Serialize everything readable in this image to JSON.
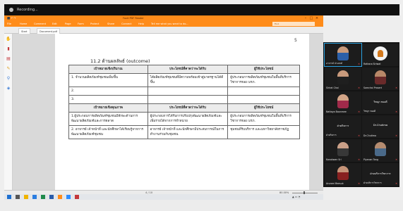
{
  "meeting": {
    "title": "Recording..."
  },
  "app": {
    "title": "Foxit PDF Reader",
    "menu_tabs": [
      "File",
      "Home",
      "Comment",
      "Edit",
      "Page",
      "Form",
      "Protect",
      "Share",
      "Connect",
      "Help"
    ],
    "search_placeholder": "Tell me what you want to do...",
    "find_placeholder": "Find",
    "doc_tabs": [
      "Start",
      "Document.pdf"
    ],
    "page_indicator": "4 / 10",
    "zoom_level": "80.00%"
  },
  "document": {
    "page_number": "5",
    "section_heading": "11.2  ด้านผลลัพธ์ (outcome)",
    "table": {
      "headers_1": [
        "เป้าหมายเชิงปริมาณ",
        "ประโยชน์ที่คาดว่าจะได้รับ",
        "ผู้ใช้ประโยชน์"
      ],
      "rows_1": [
        [
          "1. จำนวนผลิตภัณฑ์ชุมชนเพิ่มขึ้น",
          "ได้ผลิตภัณฑ์ชุมชนที่มีความพร้อมเข้าสู่มาตรฐานได้ดีขึ้น",
          "ผู้ประกอบการผลิตภัณฑ์ชุมชนในพื้นที่บริการวิชาการของ มรภ."
        ],
        [
          "2.",
          "",
          ""
        ],
        [
          "3.",
          "",
          ""
        ]
      ],
      "headers_2": [
        "เป้าหมายเชิงคุณภาพ",
        "ประโยชน์ที่คาดว่าจะได้รับ",
        "ผู้ใช้ประโยชน์"
      ],
      "rows_2": [
        [
          "1.ผู้ประกอบการผลิตภัณฑ์ชุมชนมีทักษะด้านการพัฒนาผลิตภัณฑ์และการตลาด",
          "ผู้ประกอบการได้รับการปรับปรุงพัฒนาผลิตภัณฑ์และเพิ่มรายได้จากการจำหน่าย",
          "ผู้ประกอบการผลิตภัณฑ์ชุมชนในพื้นที่บริการวิชาการของ มรภ."
        ],
        [
          "2. อาจารย์ เจ้าหน้าที่ และนักศึกษาได้เรียนรู้จากการพัฒนาผลิตภัณฑ์ชุมชน",
          "อาจารย์ เจ้าหน้าที่ และนักศึกษามีประสบการณ์ในการทำงานร่วมกับชุมชน",
          "ชุมชนที่รับบริการ และมหาวิทยาลัยราชภัฏ"
        ]
      ]
    }
  },
  "participants": [
    {
      "name": "อาจารย์ ประสงค์",
      "active": true,
      "kind": "video",
      "skin": "#c99a7a",
      "clothes": "#2b5fa8"
    },
    {
      "name": "Rattana Siriwat",
      "active": false,
      "kind": "logo",
      "skin": "",
      "clothes": ""
    },
    {
      "name": "Sirirat Chai",
      "active": false,
      "kind": "video",
      "skin": "#c89a7c",
      "clothes": "#1f1f1f"
    },
    {
      "name": "Somchai Prasert",
      "active": false,
      "kind": "video",
      "skin": "#b88868",
      "clothes": "#6a2a2a"
    },
    {
      "name": "Nattaya Boonmee",
      "active": false,
      "kind": "video",
      "skin": "#d2a487",
      "clothes": "#a02a4a"
    },
    {
      "name": "วิชญา ทองดี",
      "active": false,
      "kind": "name",
      "skin": "",
      "clothes": ""
    },
    {
      "name": "ฝ่ายกิจการ",
      "active": false,
      "kind": "name",
      "skin": "",
      "clothes": ""
    },
    {
      "name": "Dr.Chutima",
      "active": false,
      "kind": "name",
      "skin": "",
      "clothes": ""
    },
    {
      "name": "Kanokwan Sri",
      "active": false,
      "kind": "video",
      "skin": "#caa088",
      "clothes": "#383838"
    },
    {
      "name": "Piyanan Tong",
      "active": false,
      "kind": "video",
      "skin": "#b58c70",
      "clothes": "#4a6a8a"
    },
    {
      "name": "Arunee Meesuk",
      "active": false,
      "kind": "video",
      "skin": "#c59378",
      "clothes": "#882020"
    },
    {
      "name": "ฝ่ายบริการวิชาการ",
      "active": false,
      "kind": "name",
      "skin": "",
      "clothes": ""
    }
  ],
  "colors": {
    "ribbon": "#ff8c1a",
    "active_border": "#2aa1e0"
  }
}
